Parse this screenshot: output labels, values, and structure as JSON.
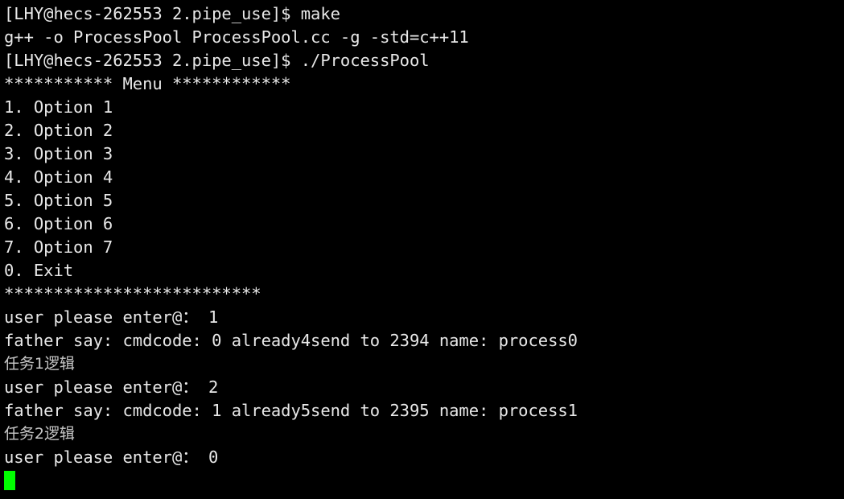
{
  "terminal": {
    "title": "Terminal",
    "background_color": "#000000",
    "foreground_color": "#e8e8e8",
    "cjk_color": "#c8c8c8",
    "cursor_color": "#00ff00",
    "prompt": "[LHY@hecs-262553 2.pipe_use]$",
    "lines": [
      {
        "name": "prompt-make",
        "text": "[LHY@hecs-262553 2.pipe_use]$ make"
      },
      {
        "name": "compile-output",
        "text": "g++ -o ProcessPool ProcessPool.cc -g -std=c++11"
      },
      {
        "name": "prompt-run",
        "text": "[LHY@hecs-262553 2.pipe_use]$ ./ProcessPool"
      },
      {
        "name": "menu-header",
        "text": "*********** Menu ************"
      },
      {
        "name": "menu-option-1",
        "text": "1. Option 1"
      },
      {
        "name": "menu-option-2",
        "text": "2. Option 2"
      },
      {
        "name": "menu-option-3",
        "text": "3. Option 3"
      },
      {
        "name": "menu-option-4",
        "text": "4. Option 4"
      },
      {
        "name": "menu-option-5",
        "text": "5. Option 5"
      },
      {
        "name": "menu-option-6",
        "text": "6. Option 6"
      },
      {
        "name": "menu-option-7",
        "text": "7. Option 7"
      },
      {
        "name": "menu-option-0",
        "text": "0. Exit"
      },
      {
        "name": "menu-separator",
        "text": "**************************"
      },
      {
        "name": "input-prompt-1",
        "text": "user please enter@： 1"
      },
      {
        "name": "father-say-1",
        "text": "father say: cmdcode: 0 already4send to 2394 name: process0"
      },
      {
        "name": "task-log-1",
        "text": "任务1逻辑",
        "cjk": true
      },
      {
        "name": "input-prompt-2",
        "text": "user please enter@： 2"
      },
      {
        "name": "father-say-2",
        "text": "father say: cmdcode: 1 already5send to 2395 name: process1"
      },
      {
        "name": "task-log-2",
        "text": "任务2逻辑",
        "cjk": true
      },
      {
        "name": "input-prompt-3",
        "text": "user please enter@： 0"
      }
    ],
    "cursor": {
      "visible": true,
      "row": 20,
      "column": 0
    }
  }
}
